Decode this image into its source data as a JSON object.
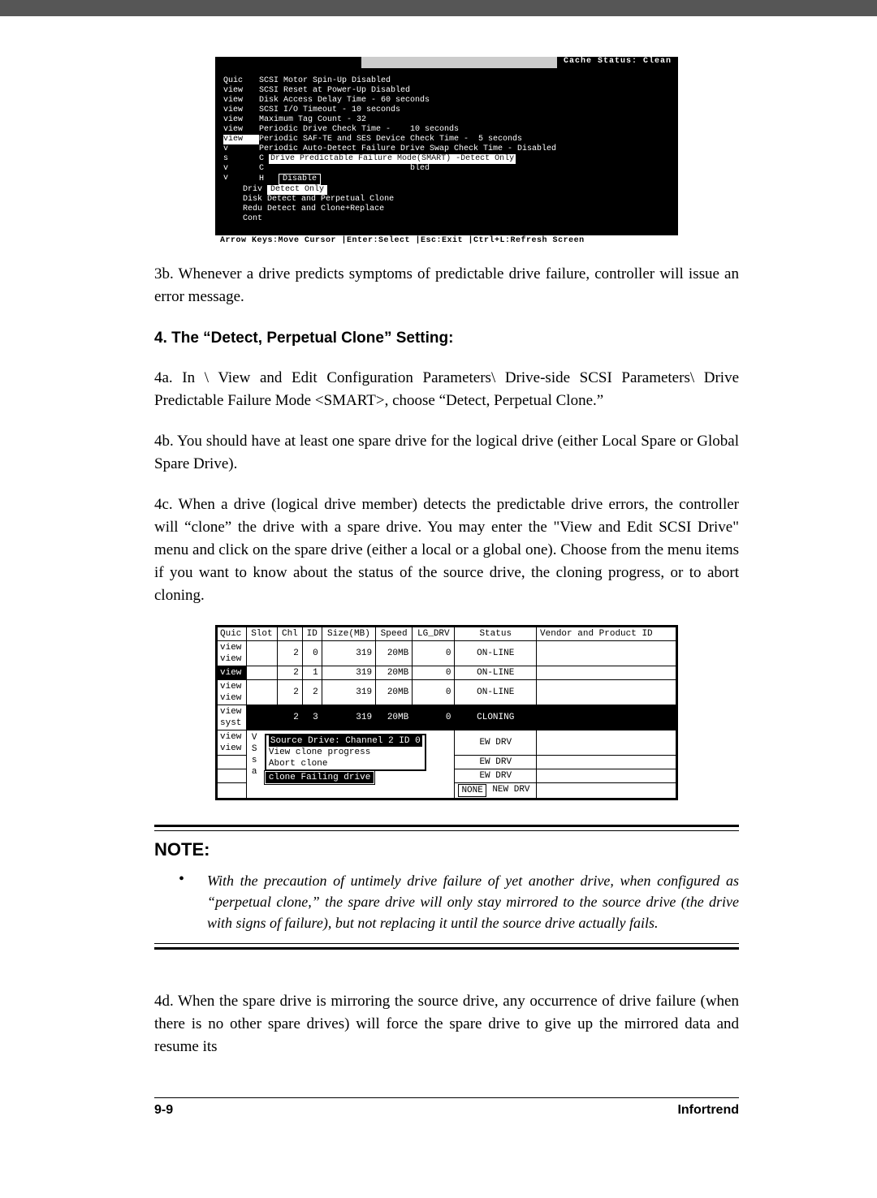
{
  "terminal1": {
    "cache_status": "Cache Status: Clean",
    "sidebar": [
      "Quic",
      "view",
      "view",
      "view",
      "view",
      "view",
      "view",
      "v",
      "s",
      "v",
      "v"
    ],
    "sidebar_hl_index": 6,
    "lines": [
      "SCSI Motor Spin-Up Disabled",
      "SCSI Reset at Power-Up Disabled",
      "Disk Access Delay Time - 60 seconds",
      "SCSI I/O Timeout - 10 seconds",
      "Maximum Tag Count - 32",
      "Periodic Drive Check Time -    10 seconds",
      "Periodic SAF-TE and SES Device Check Time -  5 seconds",
      "Periodic Auto-Detect Failure Drive Swap Check Time - Disabled"
    ],
    "hl_line": "Drive Predictable Failure Mode(SMART) -Detect Only",
    "sub_tag": "bled",
    "side_items": [
      "C",
      "C",
      "H"
    ],
    "popup_prefix": [
      "Driv",
      "Disk",
      "Redu",
      "Cont"
    ],
    "popup": [
      "Disable",
      "Detect Only",
      "Detect and Perpetual Clone",
      "Detect and Clone+Replace"
    ],
    "popup_hl_index": 1,
    "footer": "Arrow Keys:Move Cursor   |Enter:Select   |Esc:Exit   |Ctrl+L:Refresh Screen"
  },
  "para3b": "3b.  Whenever a drive predicts symptoms of predictable drive failure, controller will issue an error message.",
  "heading4": "4.  The “Detect, Perpetual Clone” Setting:",
  "para4a": "4a. In \\ View and Edit Configuration Parameters\\ Drive-side SCSI Parameters\\ Drive Predictable Failure Mode <SMART>, choose “Detect, Perpetual Clone.”",
  "para4b": "4b. You should have at least one spare drive for the logical drive (either Local Spare or Global Spare Drive).",
  "para4c": "4c. When a drive (logical drive member) detects the predictable drive errors, the controller will “clone” the drive with a spare drive. You may enter the \"View and Edit SCSI Drive\" menu and click on the spare drive (either a local or a global one).  Choose from the menu items if you want to know about the status of the source drive, the cloning progress, or to abort cloning.",
  "scsi": {
    "left_menu": [
      "Quic",
      "view",
      "view",
      "view",
      "view",
      "view",
      "view",
      "view",
      "syst",
      "view",
      "view"
    ],
    "left_hl_index": 3,
    "headers": [
      "Slot",
      "Chl",
      "ID",
      "Size(MB)",
      "Speed",
      "LG_DRV",
      "Status",
      "Vendor and Product ID"
    ],
    "rows": [
      {
        "slot": "",
        "chl": "2",
        "id": "0",
        "size": "319",
        "speed": "20MB",
        "lg": "0",
        "status": "ON-LINE",
        "vendor": ""
      },
      {
        "slot": "",
        "chl": "2",
        "id": "1",
        "size": "319",
        "speed": "20MB",
        "lg": "0",
        "status": "ON-LINE",
        "vendor": ""
      },
      {
        "slot": "",
        "chl": "2",
        "id": "2",
        "size": "319",
        "speed": "20MB",
        "lg": "0",
        "status": "ON-LINE",
        "vendor": ""
      },
      {
        "slot": "",
        "chl": "2",
        "id": "3",
        "size": "319",
        "speed": "20MB",
        "lg": "0",
        "status": "CLONING",
        "vendor": "",
        "hl": true
      }
    ],
    "tail_rows": [
      {
        "status": "EW DRV"
      },
      {
        "status": "EW DRV"
      },
      {
        "status": "EW DRV"
      },
      {
        "none": "NONE",
        "status": "NEW DRV"
      }
    ],
    "side_letters": [
      "V",
      "S",
      "s",
      "a"
    ],
    "popup": [
      "Source Drive: Channel 2 ID 0",
      "View clone progress",
      "Abort clone"
    ],
    "popup_hl_index": 0,
    "popup_title": "clone Failing drive"
  },
  "note": {
    "title": "NOTE:",
    "item": "With the precaution of untimely drive failure of yet another drive, when configured as “perpetual clone,” the spare drive will only stay mirrored to the source drive (the drive with signs of failure), but not replacing it until the source drive actually fails."
  },
  "para4d": "4d. When the spare drive is mirroring the source drive, any occurrence of drive failure (when there is no other spare drives) will force the spare drive to give up the mirrored data and resume its",
  "footer": {
    "left": "9-9",
    "right": "Infortrend"
  }
}
